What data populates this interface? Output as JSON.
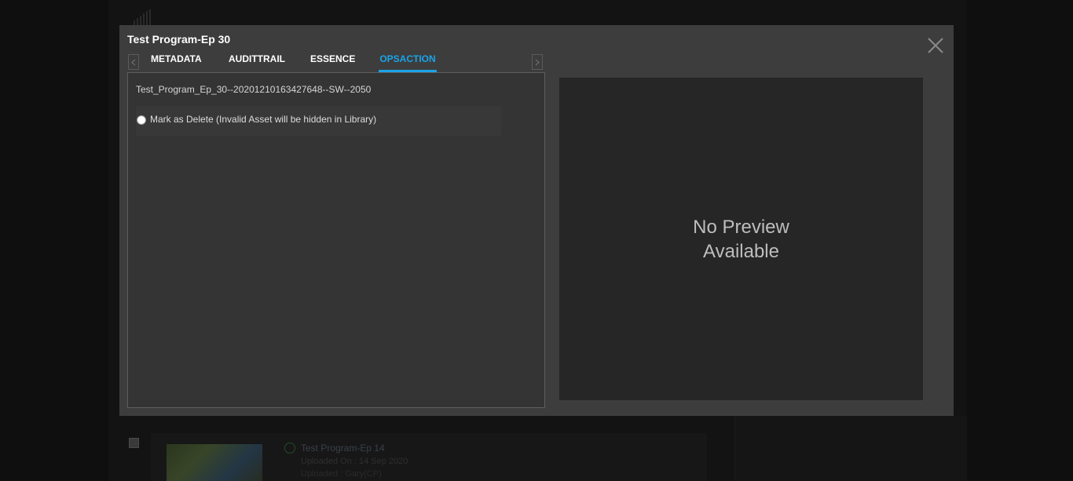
{
  "background": {
    "card": {
      "title": "Test Program-Ep 14",
      "uploaded": "Uploaded On : 14 Sep 2020",
      "user": "Uploaded : Gary(CP)"
    }
  },
  "modal": {
    "title": "Test Program-Ep 30",
    "close_icon": "close-icon",
    "tabs": [
      {
        "label": "METADATA",
        "active": false
      },
      {
        "label": "AUDITTRAIL",
        "active": false
      },
      {
        "label": "ESSENCE",
        "active": false
      },
      {
        "label": "OPSACTION",
        "active": true
      }
    ],
    "tab_prev_icon": "chevron-left-icon",
    "tab_next_icon": "chevron-right-icon",
    "opsaction": {
      "asset_id": "Test_Program_Ep_30--20201210163427648--SW--2050",
      "option_label": "Mark as Delete (Invalid Asset will be hidden in Library)",
      "option_selected": false
    },
    "preview": {
      "line1": "No Preview",
      "line2": "Available"
    }
  },
  "colors": {
    "accent": "#1aa3e8",
    "modal_bg": "#3d3d3d",
    "preview_bg": "#262626"
  }
}
